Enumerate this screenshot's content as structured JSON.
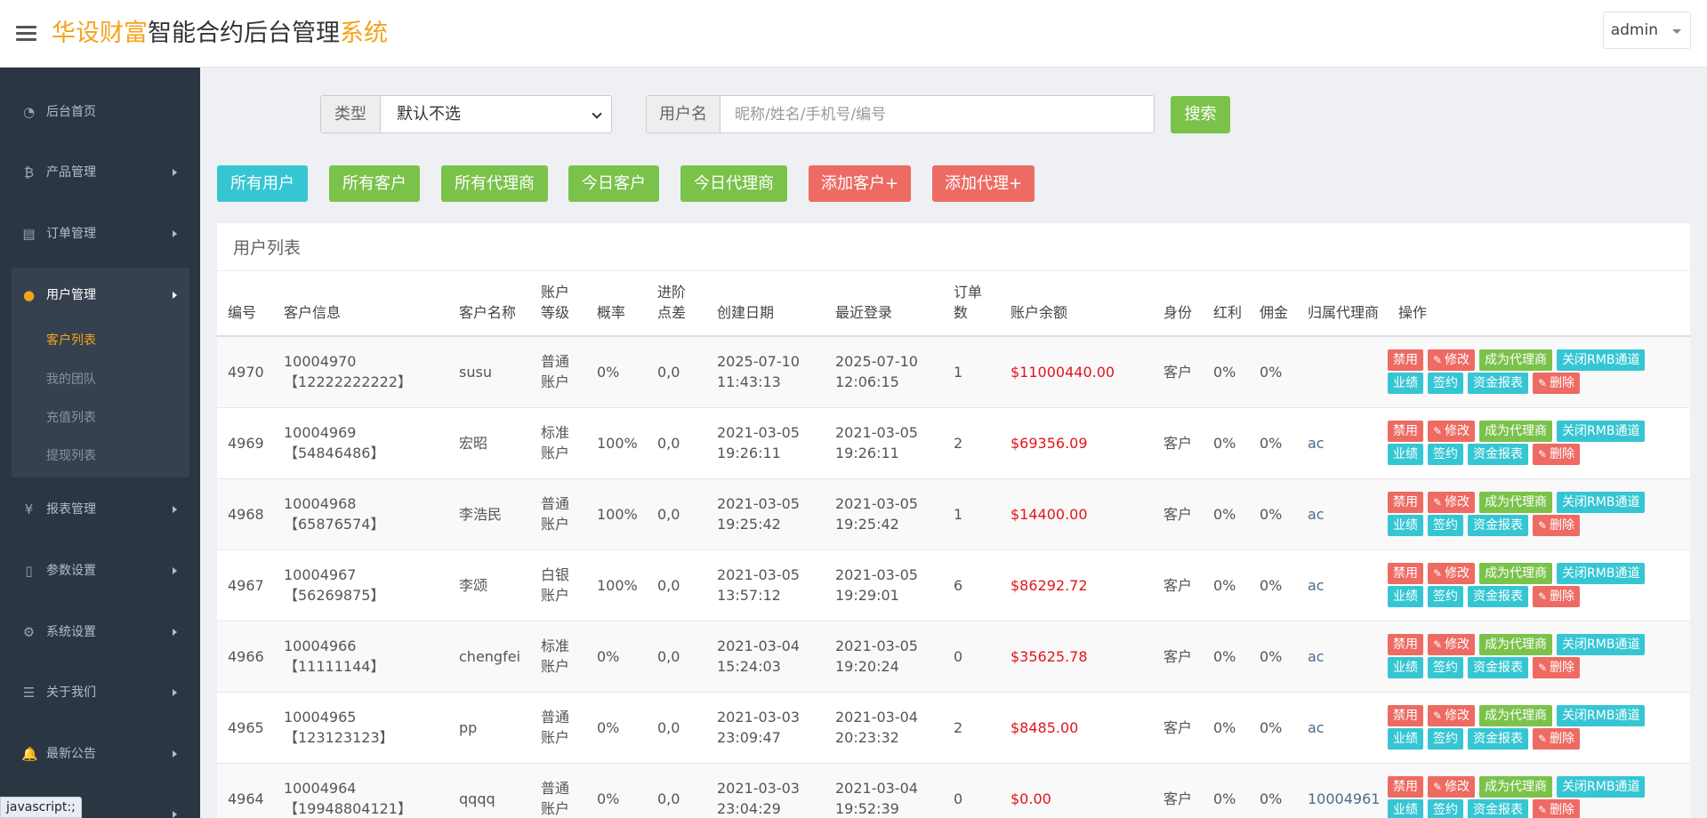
{
  "header": {
    "logo_part1": "华设财富",
    "logo_part2": "智能合约后台管理",
    "logo_part3": "系统",
    "admin_label": "admin"
  },
  "sidebar": {
    "items": [
      {
        "label": "后台首页",
        "icon": "dashboard-icon"
      },
      {
        "label": "产品管理",
        "icon": "bitcoin-icon"
      },
      {
        "label": "订单管理",
        "icon": "document-icon"
      },
      {
        "label": "用户管理",
        "icon": "user-icon"
      },
      {
        "label": "报表管理",
        "icon": "yen-icon"
      },
      {
        "label": "参数设置",
        "icon": "file-icon"
      },
      {
        "label": "系统设置",
        "icon": "gears-icon"
      },
      {
        "label": "关于我们",
        "icon": "list-icon"
      },
      {
        "label": "最新公告",
        "icon": "bell-icon"
      }
    ],
    "sub_items": [
      "客户列表",
      "我的团队",
      "充值列表",
      "提现列表"
    ]
  },
  "status_tip": "javascript:;",
  "search": {
    "type_label": "类型",
    "type_value": "默认不选",
    "user_label": "用户名",
    "user_placeholder": "昵称/姓名/手机号/编号",
    "search_button": "搜索"
  },
  "filters": [
    "所有用户",
    "所有客户",
    "所有代理商",
    "今日客户",
    "今日代理商",
    "添加客户+",
    "添加代理+"
  ],
  "panel": {
    "title": "用户列表",
    "headers": [
      "编号",
      "客户信息",
      "客户名称",
      "账户等级",
      "概率",
      "进阶点差",
      "创建日期",
      "最近登录",
      "订单数",
      "账户余额",
      "身份",
      "红利",
      "佣金",
      "归属代理商",
      "操作"
    ],
    "rows": [
      {
        "id": "4970",
        "info1": "10004970",
        "info2": "【12222222222】",
        "name": "susu",
        "level": "普通账户",
        "rate": "0%",
        "spread": "0,0",
        "created1": "2025-07-10",
        "created2": "11:43:13",
        "login1": "2025-07-10",
        "login2": "12:06:15",
        "orders": "1",
        "balance": "$11000440.00",
        "role": "客户",
        "bonus": "0%",
        "commission": "0%",
        "agent": ""
      },
      {
        "id": "4969",
        "info1": "10004969",
        "info2": "【54846486】",
        "name": "宏昭",
        "level": "标准账户",
        "rate": "100%",
        "spread": "0,0",
        "created1": "2021-03-05",
        "created2": "19:26:11",
        "login1": "2021-03-05",
        "login2": "19:26:11",
        "orders": "2",
        "balance": "$69356.09",
        "role": "客户",
        "bonus": "0%",
        "commission": "0%",
        "agent": "ac"
      },
      {
        "id": "4968",
        "info1": "10004968",
        "info2": "【65876574】",
        "name": "李浩民",
        "level": "普通账户",
        "rate": "100%",
        "spread": "0,0",
        "created1": "2021-03-05",
        "created2": "19:25:42",
        "login1": "2021-03-05",
        "login2": "19:25:42",
        "orders": "1",
        "balance": "$14400.00",
        "role": "客户",
        "bonus": "0%",
        "commission": "0%",
        "agent": "ac"
      },
      {
        "id": "4967",
        "info1": "10004967",
        "info2": "【56269875】",
        "name": "李颂",
        "level": "白银账户",
        "rate": "100%",
        "spread": "0,0",
        "created1": "2021-03-05",
        "created2": "13:57:12",
        "login1": "2021-03-05",
        "login2": "19:29:01",
        "orders": "6",
        "balance": "$86292.72",
        "role": "客户",
        "bonus": "0%",
        "commission": "0%",
        "agent": "ac"
      },
      {
        "id": "4966",
        "info1": "10004966",
        "info2": "【11111144】",
        "name": "chengfei",
        "level": "标准账户",
        "rate": "0%",
        "spread": "0,0",
        "created1": "2021-03-04",
        "created2": "15:24:03",
        "login1": "2021-03-05",
        "login2": "19:20:24",
        "orders": "0",
        "balance": "$35625.78",
        "role": "客户",
        "bonus": "0%",
        "commission": "0%",
        "agent": "ac"
      },
      {
        "id": "4965",
        "info1": "10004965",
        "info2": "【123123123】",
        "name": "pp",
        "level": "普通账户",
        "rate": "0%",
        "spread": "0,0",
        "created1": "2021-03-03",
        "created2": "23:09:47",
        "login1": "2021-03-04",
        "login2": "20:23:32",
        "orders": "2",
        "balance": "$8485.00",
        "role": "客户",
        "bonus": "0%",
        "commission": "0%",
        "agent": "ac"
      },
      {
        "id": "4964",
        "info1": "10004964",
        "info2": "【19948804121】",
        "name": "qqqq",
        "level": "普通账户",
        "rate": "0%",
        "spread": "0,0",
        "created1": "2021-03-03",
        "created2": "23:04:29",
        "login1": "2021-03-04",
        "login2": "19:52:39",
        "orders": "0",
        "balance": "$0.00",
        "role": "客户",
        "bonus": "0%",
        "commission": "0%",
        "agent": "10004961"
      }
    ],
    "op_labels": {
      "disable": "禁用",
      "edit": "修改",
      "make_agent": "成为代理商",
      "close_rmb": "关闭RMB通道",
      "perf": "业绩",
      "sign": "签约",
      "fund": "资金报表",
      "delete": "删除"
    }
  },
  "colors": {
    "accent": "#f4a31c",
    "sidebar_bg": "#2b3643",
    "teal": "#36c6d3",
    "green": "#7bc24b",
    "red": "#ed6b63",
    "money": "#e2141c"
  }
}
